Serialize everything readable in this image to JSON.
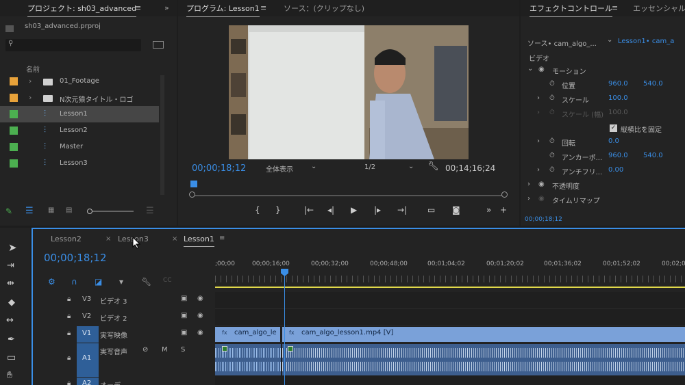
{
  "project": {
    "title": "プロジェクト: sh03_advanced",
    "file": "sh03_advanced.prproj",
    "search_placeholder": "",
    "col_name": "名前",
    "items": [
      {
        "name": "01_Footage",
        "color": "#e8a23a",
        "type": "folder"
      },
      {
        "name": "N次元猿タイトル・ロゴ",
        "color": "#e8a23a",
        "type": "folder"
      },
      {
        "name": "Lesson1",
        "color": "#4caf50",
        "type": "sequence"
      },
      {
        "name": "Lesson2",
        "color": "#4caf50",
        "type": "sequence"
      },
      {
        "name": "Master",
        "color": "#4caf50",
        "type": "sequence"
      },
      {
        "name": "Lesson3",
        "color": "#4caf50",
        "type": "sequence"
      }
    ]
  },
  "program": {
    "tab": "プログラム: Lesson1",
    "source_tab": "ソース：(クリップなし)",
    "current_tc": "00;00;18;12",
    "fit": "全体表示",
    "resolution": "1/2",
    "duration_tc": "00;14;16;24"
  },
  "effects": {
    "tab": "エフェクトコントロール",
    "tab2": "エッセンシャル",
    "source": "ソース• cam_algo_...",
    "seq": "Lesson1• cam_a",
    "video_label": "ビデオ",
    "motion": "モーション",
    "props": [
      {
        "label": "位置",
        "v1": "960.0",
        "v2": "540.0"
      },
      {
        "label": "スケール",
        "v1": "100.0",
        "v2": ""
      },
      {
        "label": "スケール (幅)",
        "v1": "100.0",
        "v2": "",
        "disabled": true
      }
    ],
    "uniform": "縦横比を固定",
    "props2": [
      {
        "label": "回転",
        "v1": "0.0",
        "v2": ""
      },
      {
        "label": "アンカーポ...",
        "v1": "960.0",
        "v2": "540.0"
      },
      {
        "label": "アンチフリ...",
        "v1": "0.00",
        "v2": ""
      }
    ],
    "opacity": "不透明度",
    "remap": "タイムリマップ",
    "tc": "00;00;18;12"
  },
  "timeline": {
    "tabs": [
      "Lesson2",
      "Lesson3",
      "Lesson1"
    ],
    "tc": "00;00;18;12",
    "ruler": [
      ";00;00",
      "00;00;16;00",
      "00;00;32;00",
      "00;00;48;00",
      "00;01;04;02",
      "00;01;20;02",
      "00;01;36;02",
      "00;01;52;02",
      "00;02;0"
    ],
    "tracks": [
      {
        "id": "V3",
        "name": "ビデオ 3"
      },
      {
        "id": "V2",
        "name": "ビデオ 2"
      },
      {
        "id": "V1",
        "name": "実写映像"
      },
      {
        "id": "A1",
        "name": "実写音声"
      },
      {
        "id": "A2",
        "name": "オーデ"
      }
    ],
    "clip1": "cam_algo_le",
    "clip2": "cam_algo_lesson1.mp4 [V]",
    "fx": "fx",
    "m": "M",
    "s": "S"
  },
  "colors": {
    "accent": "#3a8ee6",
    "clip": "#7aa1d9",
    "audio": "#3d5e8e"
  }
}
